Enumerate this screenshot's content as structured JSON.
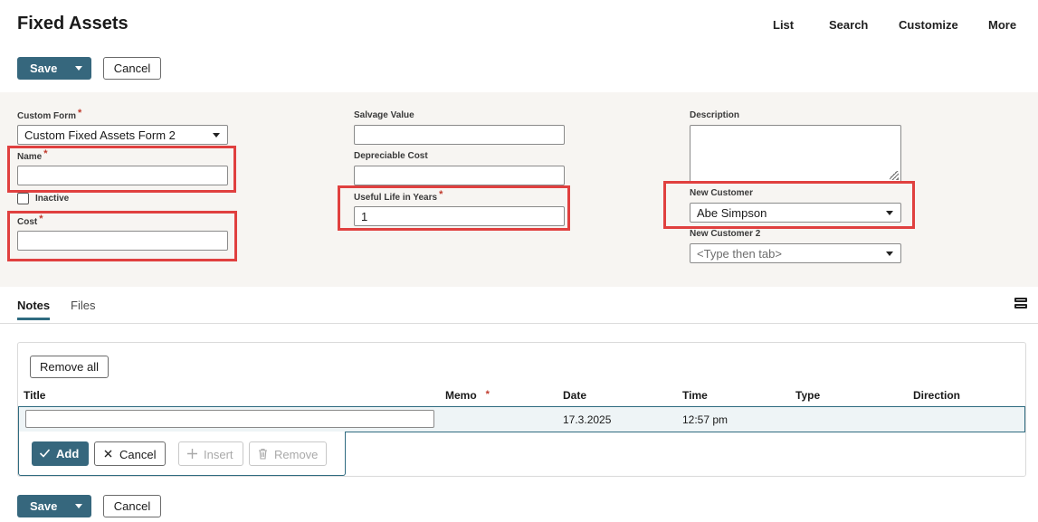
{
  "header": {
    "title": "Fixed Assets",
    "nav": [
      "List",
      "Search",
      "Customize",
      "More"
    ]
  },
  "toolbar": {
    "save_label": "Save",
    "cancel_label": "Cancel"
  },
  "form": {
    "custom_form": {
      "label": "Custom Form",
      "value": "Custom Fixed Assets Form 2"
    },
    "name": {
      "label": "Name",
      "value": ""
    },
    "inactive": {
      "label": "Inactive"
    },
    "cost": {
      "label": "Cost",
      "value": ""
    },
    "salvage_value": {
      "label": "Salvage Value",
      "value": ""
    },
    "depreciable_cost": {
      "label": "Depreciable Cost",
      "value": ""
    },
    "useful_life": {
      "label": "Useful Life in Years",
      "value": "1"
    },
    "description": {
      "label": "Description"
    },
    "new_customer": {
      "label": "New Customer",
      "value": "Abe Simpson"
    },
    "new_customer_2": {
      "label": "New Customer 2",
      "placeholder": "<Type then tab>"
    }
  },
  "tabs": [
    {
      "label": "Notes",
      "active": true
    },
    {
      "label": "Files",
      "active": false
    }
  ],
  "notes": {
    "remove_all_label": "Remove all",
    "columns": [
      "Title",
      "Memo",
      "Date",
      "Time",
      "Type",
      "Direction"
    ],
    "edit_row": {
      "title": "",
      "date": "17.3.2025",
      "time": "12:57 pm"
    },
    "actions": {
      "add": "Add",
      "cancel": "Cancel",
      "insert": "Insert",
      "remove": "Remove"
    }
  },
  "colors": {
    "primary": "#36677d",
    "highlight": "#e0403f",
    "required": "#c0392b"
  }
}
